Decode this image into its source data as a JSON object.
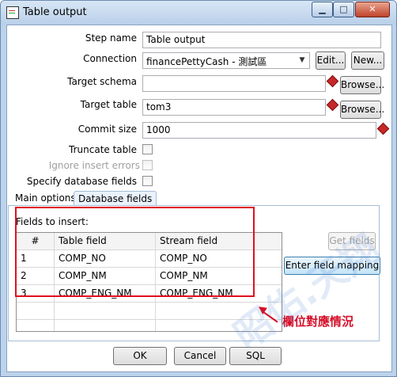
{
  "window": {
    "title": "Table output",
    "minimize_glyph": "▁",
    "maximize_glyph": "□",
    "close_glyph": "✕"
  },
  "form": {
    "step_name_label": "Step name",
    "step_name_value": "Table output",
    "connection_label": "Connection",
    "connection_value": "financePettyCash - 測試區",
    "edit_button": "Edit...",
    "new_button": "New...",
    "target_schema_label": "Target schema",
    "target_schema_value": "",
    "browse_button": "Browse...",
    "target_table_label": "Target table",
    "target_table_value": "tom3",
    "commit_size_label": "Commit size",
    "commit_size_value": "1000",
    "truncate_label": "Truncate table",
    "ignore_errors_label": "Ignore insert errors",
    "specify_fields_label": "Specify database fields"
  },
  "tabs": [
    {
      "label": "Main options"
    },
    {
      "label": "Database fields"
    }
  ],
  "db_fields": {
    "fields_to_insert_label": "Fields to insert:",
    "columns": [
      "#",
      "Table field",
      "Stream field"
    ],
    "rows": [
      {
        "num": "1",
        "table_field": "COMP_NO",
        "stream_field": "COMP_NO"
      },
      {
        "num": "2",
        "table_field": "COMP_NM",
        "stream_field": "COMP_NM"
      },
      {
        "num": "3",
        "table_field": "COMP_ENG_NM",
        "stream_field": "COMP_ENG_NM"
      }
    ],
    "get_fields_button": "Get fields",
    "mapping_button": "Enter field mapping"
  },
  "annotation": {
    "text": "欄位對應情況",
    "color": "#d4102a"
  },
  "footer": {
    "ok_button": "OK",
    "cancel_button": "Cancel",
    "sql_button": "SQL"
  },
  "watermark": "昭佑.天翔"
}
